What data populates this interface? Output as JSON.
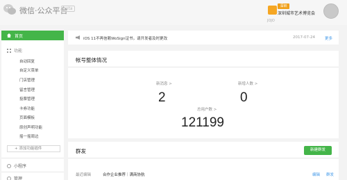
{
  "header": {
    "brand": "微信·公众平台",
    "beta": "beta",
    "account_badge": "深圳",
    "account_name": "深圳城市艺术博览会",
    "user_name": "JOJO"
  },
  "sidebar": {
    "home": "首页",
    "group_label": "功能",
    "items": [
      {
        "label": "自动回复"
      },
      {
        "label": "自定义菜单"
      },
      {
        "label": "门店管理"
      },
      {
        "label": "留言管理"
      },
      {
        "label": "投票管理"
      },
      {
        "label": "卡券功能"
      },
      {
        "label": "页面模板"
      },
      {
        "label": "原创声明功能"
      },
      {
        "label": "摇一摇周边"
      }
    ],
    "add_plugin": "+ 添加功能插件",
    "mini_program": "小程序",
    "manage": "管理"
  },
  "notice": {
    "text": "iOS 11不再信赖WoSign证书，请开发者及时更改",
    "date": "2017-07-24",
    "more": "更多"
  },
  "overview": {
    "title": "帐号整体情况",
    "new_messages_label": "新消息 >",
    "new_messages_value": "2",
    "new_followers_label": "新增人数 >",
    "new_followers_value": "0",
    "total_users_label": "总用户数 >",
    "total_users_value": "121199"
  },
  "mass": {
    "title": "群发",
    "new_button": "新建群发",
    "recent_label": "最近编辑",
    "recent_title": "合作企业推荐｜满商协航",
    "edit": "编辑",
    "send": "群发"
  },
  "colors": {
    "accent_green": "#44b549",
    "link_blue": "#459ae9"
  }
}
